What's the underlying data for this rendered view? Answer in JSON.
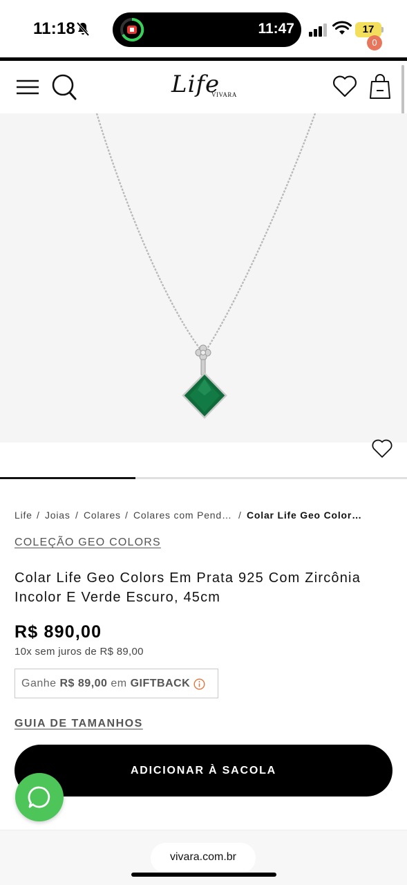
{
  "status_bar": {
    "time": "11:18",
    "island_time": "11:47",
    "battery": "17",
    "icons": [
      "bell-slash-icon",
      "cellular-signal-icon",
      "wifi-icon",
      "battery-icon"
    ]
  },
  "header": {
    "logo_text": "Life",
    "logo_sub": "VIVARA",
    "bag_count": "0",
    "icons": [
      "menu-icon",
      "search-icon",
      "heart-icon",
      "shopping-bag-icon"
    ]
  },
  "product_image": {
    "alt": "necklace",
    "gem_color": "#0f6b3a",
    "carousel_position": 1,
    "carousel_total": 3
  },
  "breadcrumb": {
    "items": [
      "Life",
      "Joias",
      "Colares",
      "Colares com Pend…"
    ],
    "current": "Colar Life Geo Color…",
    "separator": "/"
  },
  "product": {
    "collection": "COLEÇÃO GEO COLORS",
    "title": "Colar Life Geo Colors Em Prata 925 Com Zircônia Incolor E Verde Escuro, 45cm",
    "price": "R$ 890,00",
    "installments": "10x sem juros de R$ 89,00",
    "giftback_prefix": "Ganhe",
    "giftback_amount": "R$ 89,00",
    "giftback_mid": "em",
    "giftback_label": "GIFTBACK",
    "size_guide": "GUIA DE TAMANHOS",
    "add_to_bag": "ADICIONAR À SACOLA"
  },
  "browser": {
    "url": "vivara.com.br"
  },
  "colors": {
    "accent_badge": "#e8765c",
    "whatsapp": "#4dc559",
    "button": "#000000",
    "battery": "#f3df5b"
  }
}
